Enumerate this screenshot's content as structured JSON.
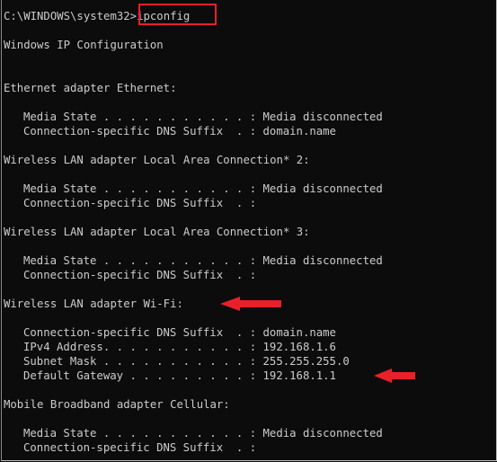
{
  "prompt": {
    "path": "C:\\WINDOWS\\system32>",
    "command": "ipconfig"
  },
  "title": "Windows IP Configuration",
  "adapters": [
    {
      "header": "Ethernet adapter Ethernet:",
      "lines": [
        "Media State . . . . . . . . . . . : Media disconnected",
        "Connection-specific DNS Suffix  . : domain.name"
      ]
    },
    {
      "header": "Wireless LAN adapter Local Area Connection* 2:",
      "lines": [
        "Media State . . . . . . . . . . . : Media disconnected",
        "Connection-specific DNS Suffix  . :"
      ]
    },
    {
      "header": "Wireless LAN adapter Local Area Connection* 3:",
      "lines": [
        "Media State . . . . . . . . . . . : Media disconnected",
        "Connection-specific DNS Suffix  . :"
      ]
    },
    {
      "header": "Wireless LAN adapter Wi-Fi:",
      "lines": [
        "Connection-specific DNS Suffix  . : domain.name",
        "IPv4 Address. . . . . . . . . . . : 192.168.1.6",
        "Subnet Mask . . . . . . . . . . . : 255.255.255.0",
        "Default Gateway . . . . . . . . . : 192.168.1.1"
      ]
    },
    {
      "header": "Mobile Broadband adapter Cellular:",
      "lines": [
        "Media State . . . . . . . . . . . : Media disconnected",
        "Connection-specific DNS Suffix  . :"
      ]
    }
  ],
  "annotations": {
    "color": "#e8202a"
  }
}
